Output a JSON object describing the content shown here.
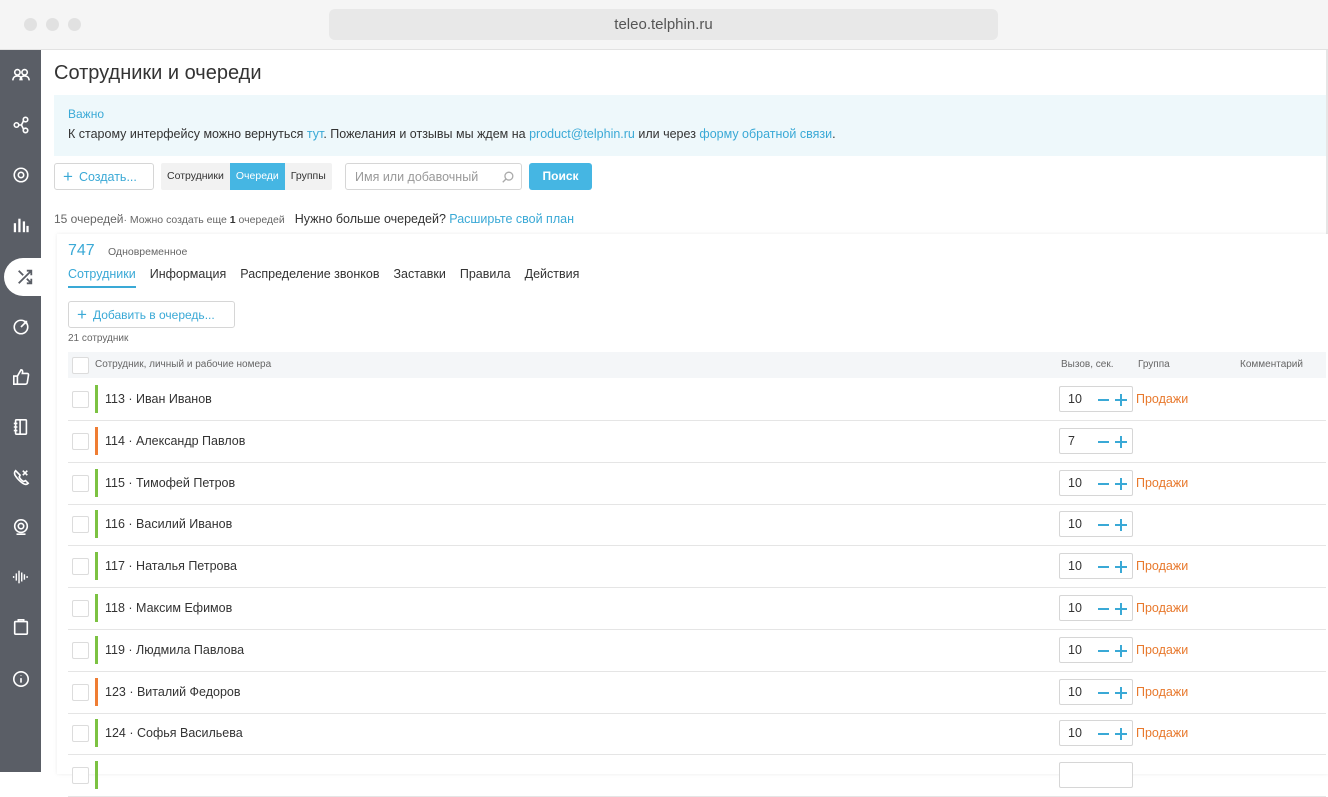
{
  "browser": {
    "url": "teleo.telphin.ru"
  },
  "page": {
    "title": "Сотрудники и очереди"
  },
  "notice": {
    "heading": "Важно",
    "text_1": "К старому интерфейсу можно вернуться ",
    "link_here": "тут",
    "text_2": ". Пожелания и отзывы мы ждем на ",
    "email": "product@telphin.ru",
    "text_3": " или через ",
    "feedback_link": "форму обратной связи",
    "text_4": "."
  },
  "toolbar": {
    "create_label": "Создать...",
    "segments": [
      "Сотрудники",
      "Очереди",
      "Группы"
    ],
    "active_segment": "Очереди",
    "search_placeholder": "Имя или добавочный",
    "search_value": "",
    "search_button": "Поиск"
  },
  "summary": {
    "count": "15 очередей",
    "can_create_prefix": "· Можно создать еще ",
    "can_create_num": "1",
    "can_create_suffix": " очередей",
    "need_more": "Нужно больше очередей?",
    "upgrade": "Расширьте свой план"
  },
  "queue": {
    "number": "747",
    "mode": "Одновременное",
    "tabs": [
      "Сотрудники",
      "Информация",
      "Распределение звонков",
      "Заставки",
      "Правила",
      "Действия"
    ],
    "active_tab": "Сотрудники",
    "add_label": "Добавить в очередь...",
    "employee_count": "21 сотрудник",
    "columns": {
      "employee": "Сотрудник, личный и рабочие номера",
      "call": "Вызов, сек.",
      "group": "Группа",
      "comment": "Комментарий"
    },
    "rows": [
      {
        "name": "113 · Иван Иванов",
        "seconds": "10",
        "group": "Продажи",
        "status_color": "#7cc242"
      },
      {
        "name": "114 · Александр Павлов",
        "seconds": "7",
        "group": "",
        "status_color": "#ef7d33"
      },
      {
        "name": "115 · Тимофей Петров",
        "seconds": "10",
        "group": "Продажи",
        "status_color": "#7cc242"
      },
      {
        "name": "116 · Василий Иванов",
        "seconds": "10",
        "group": "",
        "status_color": "#7cc242"
      },
      {
        "name": "117 · Наталья Петрова",
        "seconds": "10",
        "group": "Продажи",
        "status_color": "#7cc242"
      },
      {
        "name": "118 · Максим Ефимов",
        "seconds": "10",
        "group": "Продажи",
        "status_color": "#7cc242"
      },
      {
        "name": "119 · Людмила Павлова",
        "seconds": "10",
        "group": "Продажи",
        "status_color": "#7cc242"
      },
      {
        "name": "123 · Виталий Федоров",
        "seconds": "10",
        "group": "Продажи",
        "status_color": "#ef7d33"
      },
      {
        "name": "124 · Софья Васильева",
        "seconds": "10",
        "group": "Продажи",
        "status_color": "#7cc242"
      }
    ]
  },
  "sidebar": {
    "icons": [
      "users-icon",
      "share-nodes-icon",
      "gear-icon",
      "stats-bars-icon",
      "routing-icon",
      "target-icon",
      "thumbs-up-icon",
      "contacts-book-icon",
      "missed-call-icon",
      "webcam-icon",
      "sound-wave-icon",
      "clipboard-icon",
      "info-icon"
    ],
    "active_icon": "routing-icon"
  }
}
